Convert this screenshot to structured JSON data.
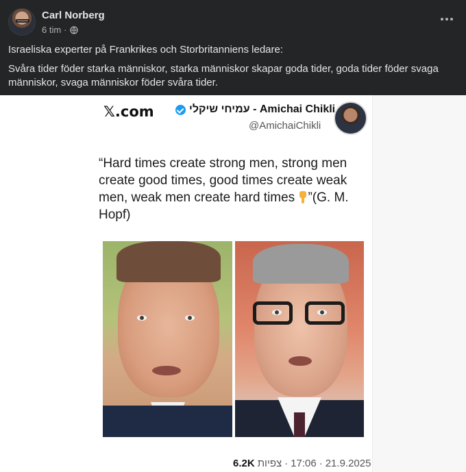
{
  "post": {
    "author": "Carl Norberg",
    "time": "6 tim",
    "separator": "·",
    "text_line1": "Israeliska experter på Frankrikes och Storbritanniens ledare:",
    "text_line2": "Svåra tider föder starka människor, starka människor skapar goda tider, goda tider föder svaga människor, svaga människor föder svåra tider."
  },
  "tweet": {
    "site": "𝕏.com",
    "name": "עמיחי שיקלי - Amichai Chikli",
    "handle": "@AmichaiChikli",
    "quote_part1": "“Hard times create strong men, strong men create good times, good times create weak men, weak men create hard times ",
    "quote_part2": "”(G. M. Hopf)",
    "views_count": "6.2K",
    "views_label": "צפיות",
    "dot": "·",
    "time": "17:06",
    "date": "21.9.2025"
  },
  "colors": {
    "background": "#242526",
    "verified": "#1d9bf0"
  },
  "icons": {
    "visibility": "globe-icon",
    "menu": "more-dots-icon",
    "badge": "verified-icon",
    "emoji": "pointing-down-finger-icon"
  }
}
